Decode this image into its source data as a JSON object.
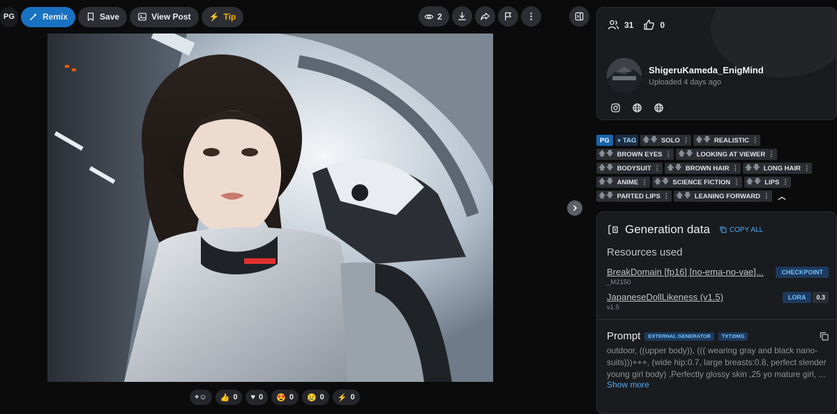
{
  "toolbar": {
    "rating": "PG",
    "remix": "Remix",
    "save": "Save",
    "view_post": "View Post",
    "tip": "Tip",
    "views_count": "2"
  },
  "reactions": [
    {
      "icon": "add-reaction-icon",
      "glyph": "+☺",
      "count": ""
    },
    {
      "icon": "thumbs-up-icon",
      "glyph": "👍",
      "count": "0"
    },
    {
      "icon": "heart-icon",
      "glyph": "♥",
      "count": "0"
    },
    {
      "icon": "heart-eyes-icon",
      "glyph": "😍",
      "count": "0"
    },
    {
      "icon": "cry-icon",
      "glyph": "😢",
      "count": "0"
    },
    {
      "icon": "bolt-icon",
      "glyph": "⚡",
      "count": "0"
    }
  ],
  "stats": {
    "followers": "31",
    "likes": "0"
  },
  "user": {
    "name": "ShigeruKameda_EnigMind",
    "uploaded": "Uploaded 4 days ago"
  },
  "tags": {
    "rating": "PG",
    "add": "+ TAG",
    "rows": [
      [
        "SOLO",
        "REALISTIC"
      ],
      [
        "BROWN EYES",
        "LOOKING AT VIEWER"
      ],
      [
        "BODYSUIT",
        "BROWN HAIR",
        "LONG HAIR"
      ],
      [
        "ANIME",
        "SCIENCE FICTION",
        "LIPS"
      ],
      [
        "PARTED LIPS",
        "LEANING FORWARD"
      ]
    ]
  },
  "generation": {
    "title": "Generation data",
    "copy_all": "COPY ALL",
    "resources_title": "Resources used",
    "resources": [
      {
        "name": "BreakDomain [fp16] [no-ema-no-vae]...",
        "version": "_M2150",
        "type": "CHECKPOINT",
        "weight": ""
      },
      {
        "name": "JapaneseDollLikeness (v1.5)",
        "version": "v1.5",
        "type": "LORA",
        "weight": "0.3"
      }
    ],
    "prompt_title": "Prompt",
    "prompt_chips": [
      "EXTERNAL GENERATOR",
      "TXT2IMG"
    ],
    "prompt_text": "outdoor, ((upper body)), ((( wearing gray and black nano-suits)))+++, (wide hip:0.7, large breasts:0.8, perfect slender young girl body) ,Perfectly glossy skin ,25 yo mature girl, ...",
    "show_more": "Show more"
  }
}
